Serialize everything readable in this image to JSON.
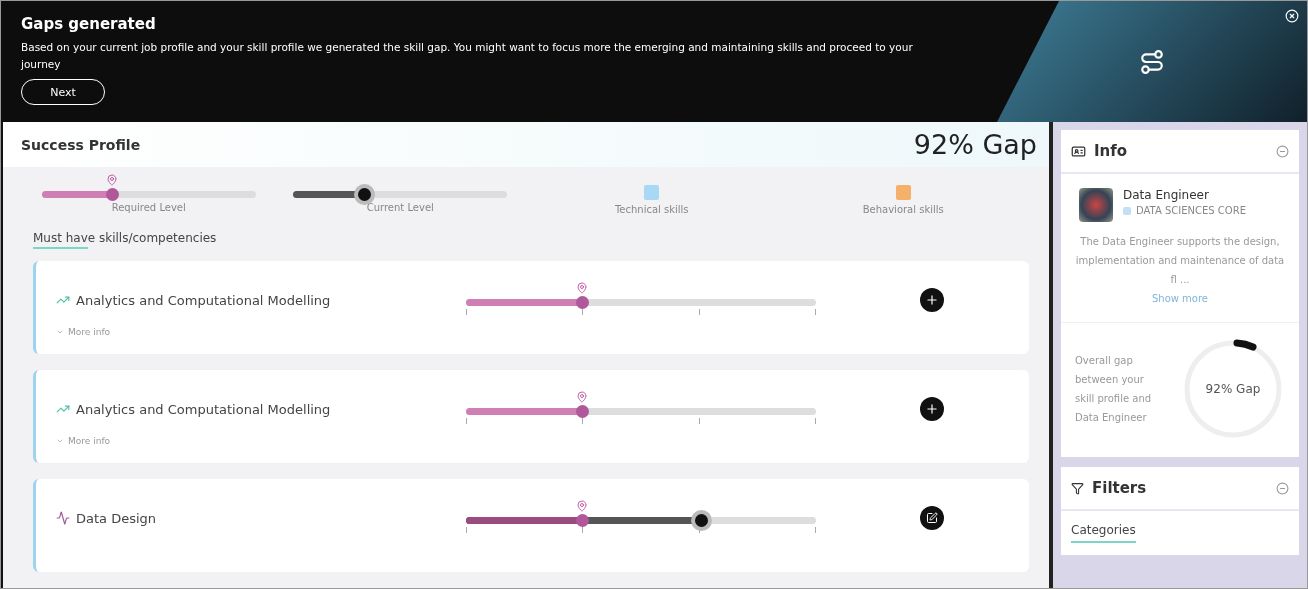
{
  "banner": {
    "title": "Gaps generated",
    "message": "Based on your current job profile and your skill profile we generated the skill gap. You might want to focus more the emerging and maintaining skills and proceed to your journey",
    "button": "Next"
  },
  "profile": {
    "title": "Success Profile",
    "gap": "92% Gap"
  },
  "legend": [
    {
      "kind": "required",
      "label": "Required Level",
      "level": 0.33
    },
    {
      "kind": "current",
      "label": "Current Level",
      "level": 0.33
    },
    {
      "kind": "swatch",
      "label": "Technical skills",
      "color": "#a8d8f5"
    },
    {
      "kind": "swatch",
      "label": "Behavioral skills",
      "color": "#f5b06a"
    }
  ],
  "section": "Must have skills/competencies",
  "skills": [
    {
      "name": "Analytics and Computational Modelling",
      "kind": "technical",
      "required": {
        "level": 0.33
      },
      "more": "More info"
    },
    {
      "name": "Analytics and Computational Modelling",
      "kind": "technical",
      "required": {
        "level": 0.33
      },
      "more": "More info"
    },
    {
      "name": "Data Design",
      "kind": "behavioral",
      "required": {
        "level": 0.33
      },
      "current": {
        "level": 0.67
      }
    }
  ],
  "info": {
    "title": "Info",
    "role": "Data Engineer",
    "category": "DATA SCIENCES CORE",
    "description": "The Data Engineer supports the design, implementation and maintenance of data fl ...",
    "link": "Show more",
    "gap_text": "Overall gap between your skill profile and Data Engineer",
    "gap": "92% Gap"
  },
  "filters": {
    "title": "Filters",
    "tab": "Categories"
  }
}
